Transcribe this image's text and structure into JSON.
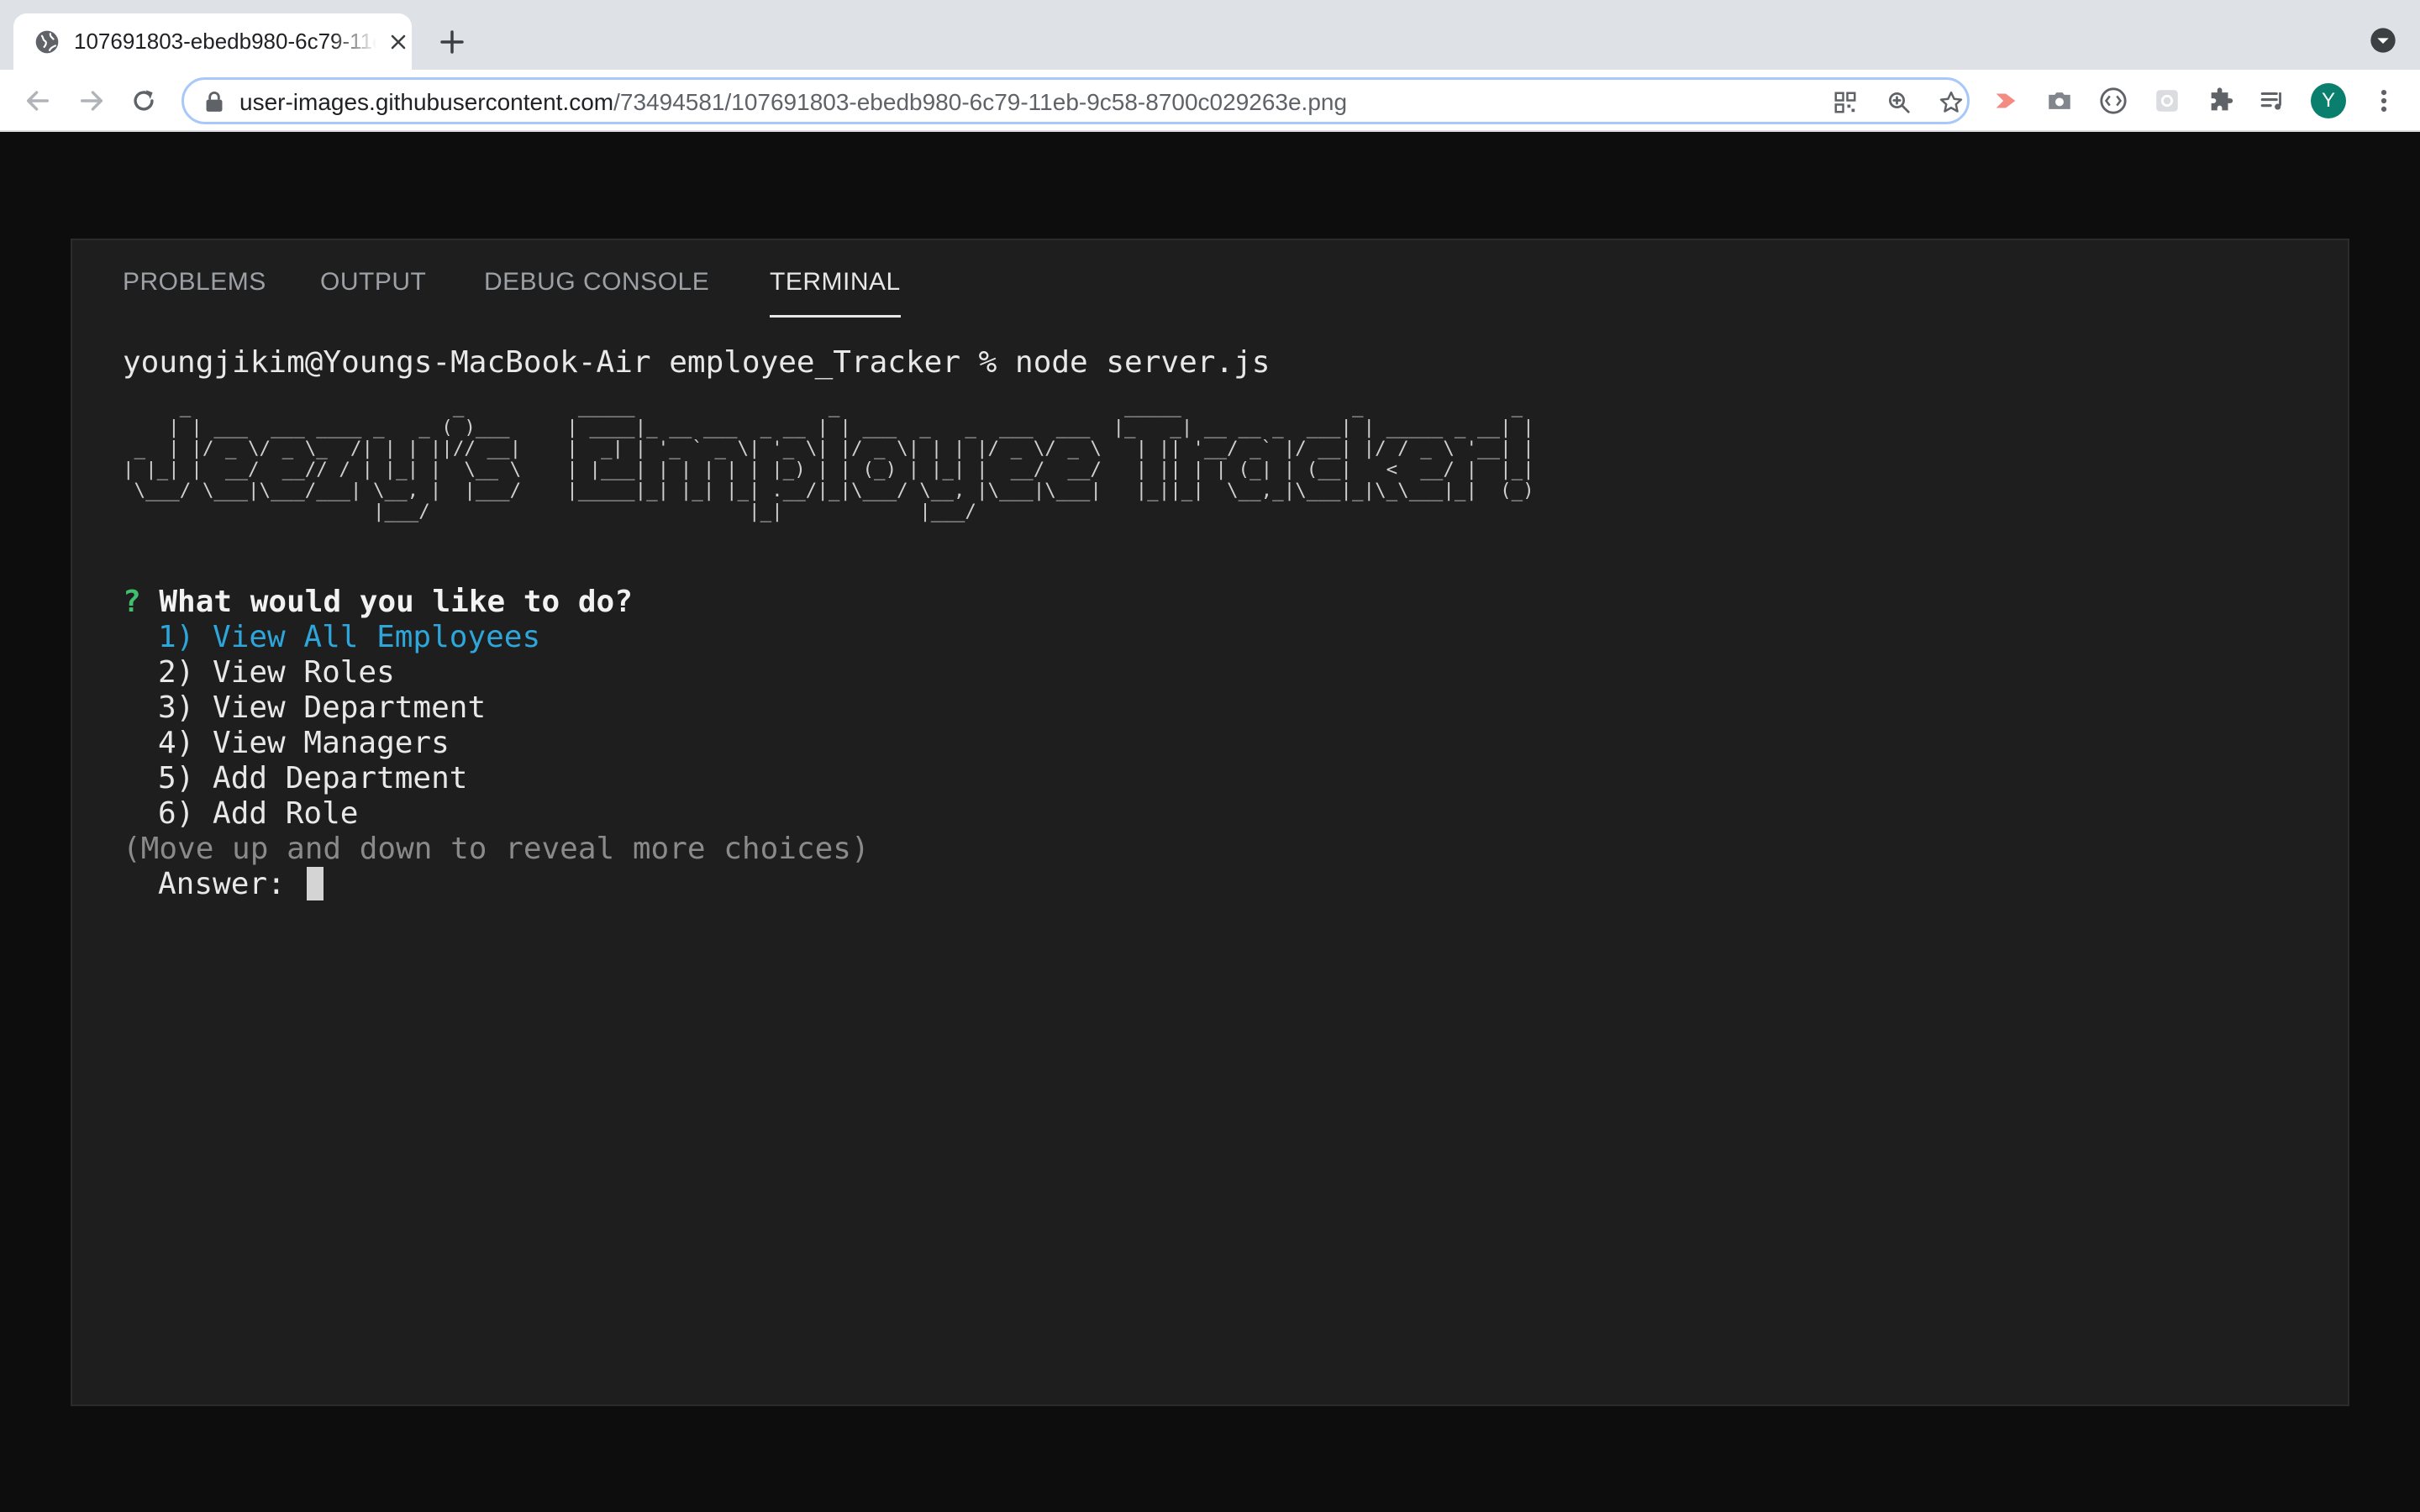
{
  "browser": {
    "tab_title": "107691803-ebedb980-6c79-11eb-9c58-8700c029263e.png",
    "url_host": "user-images.githubusercontent.com",
    "url_path": "/73494581/107691803-ebedb980-6c79-11eb-9c58-8700c029263e.png",
    "avatar_letter": "Y",
    "avatar_color": "#0b7f6e"
  },
  "panel": {
    "tabs": [
      {
        "label": "PROBLEMS",
        "active": false
      },
      {
        "label": "OUTPUT",
        "active": false
      },
      {
        "label": "DEBUG CONSOLE",
        "active": false
      },
      {
        "label": "TERMINAL",
        "active": true
      }
    ]
  },
  "terminal": {
    "prompt": "youngjikim@Youngs-MacBook-Air employee_Tracker % node server.js",
    "banner_art": "     _                       _          _____                 _                         _____               _             _ \n    | | ___  ___ ____ _   _ ( )___     | ____|_ __ ___  _ __ | | ___  _   _  ___  ___  |_   _| __ __ _  ___| | _____ _ __| |\n _  | |/ _ \\/ _ \\_  /| | | ||// __|    |  _| | '_ ` _ \\| '_ \\| |/ _ \\| | | |/ _ \\/ _ \\   | || '__/ _` |/ __| |/ / _ \\ '__| |\n| |_| |  __/  __// / | |_| |  \\__ \\    | |___| | | | | | |_) | | (_) | |_| |  __/  __/   | || | | (_| | (__|   <  __/ |  |_|\n \\___/ \\___|\\___/___| \\__, |  |___/    |_____|_| |_| |_| .__/|_|\\___/ \\__, |\\___|\\___|   |_||_|  \\__,_|\\___|_|\\_\\___|_|  (_)\n                      |___/                            |_|            |___/                                                  ",
    "question_mark": "?",
    "question": "What would you like to do?",
    "choices": [
      "1) View All Employees",
      "2) View Roles",
      "3) View Department",
      "4) View Managers",
      "5) Add Department",
      "6) Add Role"
    ],
    "hint": "(Move up and down to reveal more choices)",
    "answer_label": "Answer:"
  }
}
